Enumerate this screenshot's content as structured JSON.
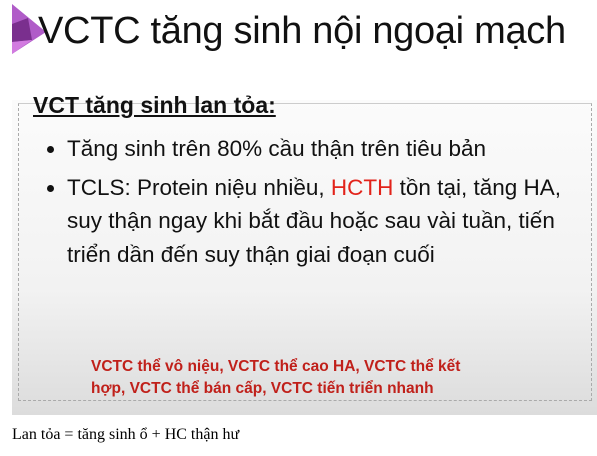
{
  "slide": {
    "title": "VCTC tăng sinh nội ngoại mạch",
    "heading": "VCT tăng sinh lan tỏa:",
    "bullets": [
      {
        "text": "Tăng sinh trên 80% cầu thận trên tiêu bản"
      },
      {
        "before": "TCLS: Protein niệu nhiều, ",
        "highlight": "HCTH",
        "after": " tồn tại, tăng HA, suy thận ngay khi bắt đầu hoặc sau vài tuần, tiến triển dần đến suy thận giai đoạn cuối"
      }
    ],
    "note": "VCTC thể vô niệu, VCTC thể cao HA, VCTC thể kết hợp, VCTC thể bán cấp, VCTC tiến triển nhanh",
    "colors": {
      "highlight": "#e2231a",
      "note": "#c0201a"
    }
  },
  "caption": "Lan tỏa = tăng sinh ổ + HC thận hư"
}
